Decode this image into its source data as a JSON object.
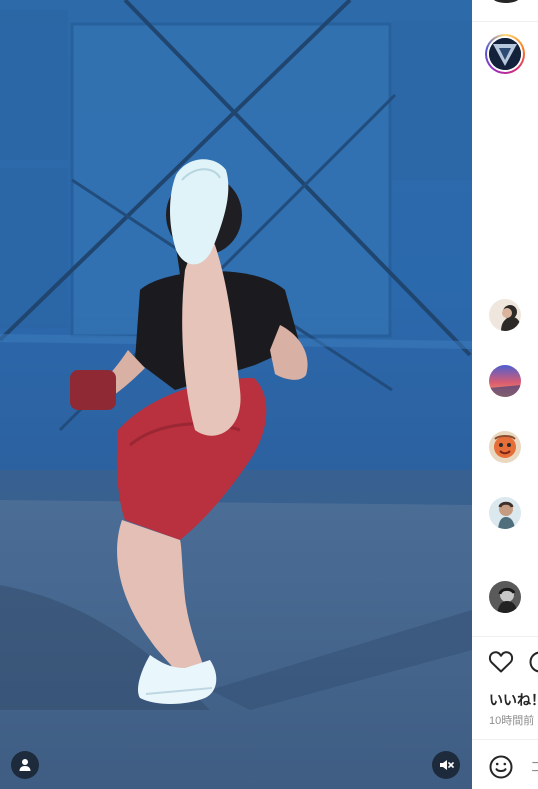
{
  "video": {
    "user_tag_icon": "person-icon",
    "mute_icon": "speaker-muted-icon"
  },
  "sidebar": {
    "author_avatar_icon": "author-avatar",
    "comment_avatars": [
      "avatar-person",
      "avatar-sunset",
      "avatar-cartoon",
      "avatar-portrait",
      "avatar-monochrome"
    ],
    "actions": {
      "like_icon": "heart-icon",
      "comment_icon": "comment-bubble-icon"
    },
    "likes_label": "いいね！",
    "timestamp": "10時間前",
    "composer": {
      "emoji_icon": "smiley-icon",
      "placeholder": "コ"
    }
  }
}
